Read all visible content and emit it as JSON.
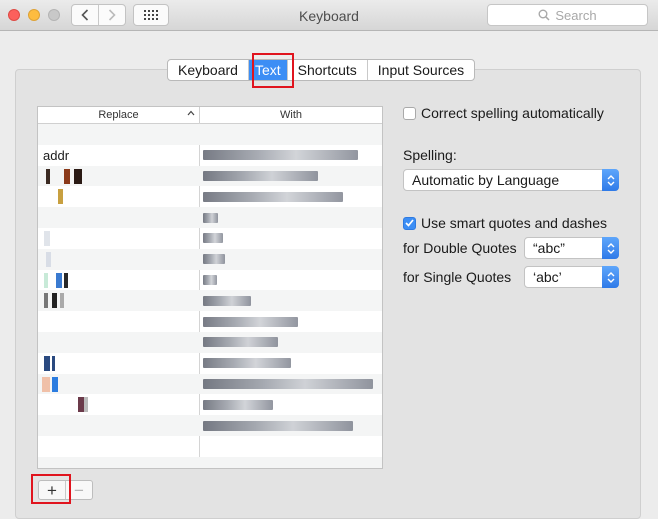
{
  "window": {
    "title": "Keyboard",
    "search_placeholder": "Search"
  },
  "tabs": [
    {
      "label": "Keyboard",
      "selected": false
    },
    {
      "label": "Text",
      "selected": true
    },
    {
      "label": "Shortcuts",
      "selected": false
    },
    {
      "label": "Input Sources",
      "selected": false
    }
  ],
  "table": {
    "columns": {
      "replace": "Replace",
      "with": "With"
    },
    "rows": [
      {
        "replace": "",
        "with": ""
      },
      {
        "replace": "addr",
        "with": "(obscured)"
      },
      {
        "replace": "(obscured)",
        "with": "(obscured)"
      },
      {
        "replace": "(obscured)",
        "with": "(obscured)"
      },
      {
        "replace": "(obscured)",
        "with": "(obscured)"
      },
      {
        "replace": "(obscured)",
        "with": "(obscured)"
      },
      {
        "replace": "(obscured)",
        "with": "(obscured)"
      },
      {
        "replace": "(obscured)",
        "with": "(obscured)"
      },
      {
        "replace": "(obscured)",
        "with": "(obscured)"
      },
      {
        "replace": "(obscured)",
        "with": "(obscured)"
      },
      {
        "replace": "(obscured)",
        "with": "(obscured)"
      },
      {
        "replace": "(obscured)",
        "with": "(obscured)"
      },
      {
        "replace": "(obscured)",
        "with": "(obscured)"
      },
      {
        "replace": "(obscured)",
        "with": "(obscured)"
      },
      {
        "replace": "(obscured)",
        "with": "(obscured)"
      },
      {
        "replace": "",
        "with": ""
      },
      {
        "replace": "",
        "with": ""
      }
    ]
  },
  "buttons": {
    "add": "+",
    "remove": "−"
  },
  "options": {
    "correct_spelling": {
      "label": "Correct spelling automatically",
      "checked": false
    },
    "spelling_label": "Spelling:",
    "spelling_value": "Automatic by Language",
    "smart_quotes": {
      "label": "Use smart quotes and dashes",
      "checked": true
    },
    "double_quotes_label": "for Double Quotes",
    "double_quotes_value": "“abc”",
    "single_quotes_label": "for Single Quotes",
    "single_quotes_value": "‘abc’"
  },
  "colors": {
    "accent": "#3c8ef5",
    "highlight_box": "#e0141e"
  }
}
